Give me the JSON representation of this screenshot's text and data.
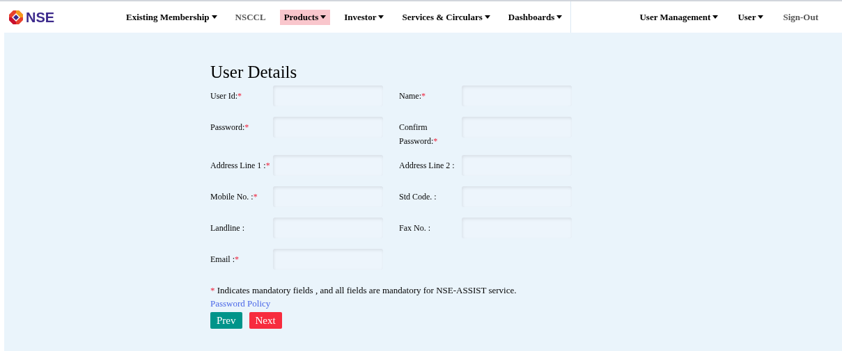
{
  "logo": {
    "text": "NSE"
  },
  "nav": [
    {
      "label": "Existing Membership",
      "dropdown": true,
      "selected": false
    },
    {
      "label": "NSCCL",
      "dropdown": false,
      "selected": false
    },
    {
      "label": "Products",
      "dropdown": true,
      "selected": true
    },
    {
      "label": "Investor",
      "dropdown": true,
      "selected": false
    },
    {
      "label": "Services & Circulars",
      "dropdown": true,
      "selected": false
    },
    {
      "label": "Dashboards",
      "dropdown": true,
      "selected": false
    }
  ],
  "nav_right": [
    {
      "label": "User Management",
      "dropdown": true,
      "selected": false
    },
    {
      "label": "User",
      "dropdown": true,
      "selected": false
    },
    {
      "label": "Sign-Out",
      "dropdown": false,
      "selected": false
    }
  ],
  "form": {
    "title": "User Details",
    "fields": [
      {
        "label": "User Id:",
        "mark": "*"
      },
      {
        "label": "Name:",
        "mark": "*"
      },
      {
        "label": "Password:",
        "mark": "*"
      },
      {
        "label": "Confirm Password:",
        "mark": "*"
      },
      {
        "label": "Address Line 1 :",
        "mark": "*"
      },
      {
        "label": "Address Line 2 :"
      },
      {
        "label": "Mobile No. :",
        "mark": "*"
      },
      {
        "label": "Std Code. :"
      },
      {
        "label": "Landline :"
      },
      {
        "label": "Fax No. :"
      },
      {
        "label": "Email :",
        "mark": "*"
      }
    ],
    "note": {
      "mark": "*",
      "text": "Indicates mandatory fields , and all fields are mandatory for NSE-ASSIST service."
    },
    "link": "Password Policy",
    "buttons": [
      {
        "label": "Prev",
        "kind": "secondary"
      },
      {
        "label": "Next",
        "kind": "primary"
      }
    ]
  }
}
